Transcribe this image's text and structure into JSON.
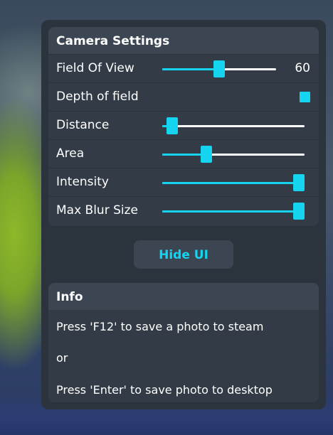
{
  "camera_settings": {
    "title": "Camera Settings",
    "rows": [
      {
        "label": "Field Of View",
        "type": "slider",
        "value": 0.5,
        "display_value": "60"
      },
      {
        "label": "Depth of field",
        "type": "checkbox",
        "checked": true
      },
      {
        "label": "Distance",
        "type": "slider",
        "value": 0.07
      },
      {
        "label": "Area",
        "type": "slider",
        "value": 0.31
      },
      {
        "label": "Intensity",
        "type": "slider",
        "value": 1.0
      },
      {
        "label": "Max Blur Size",
        "type": "slider",
        "value": 1.0
      }
    ]
  },
  "hide_ui_label": "Hide UI",
  "info": {
    "title": "Info",
    "lines": [
      "Press 'F12' to save a photo to steam",
      "or",
      "Press 'Enter' to save photo to desktop"
    ]
  },
  "colors": {
    "accent": "#14d4ef",
    "panel_bg": "#2b333d",
    "section_bg": "#323b46",
    "header_bg": "#3c4652",
    "text": "#ffffff"
  }
}
